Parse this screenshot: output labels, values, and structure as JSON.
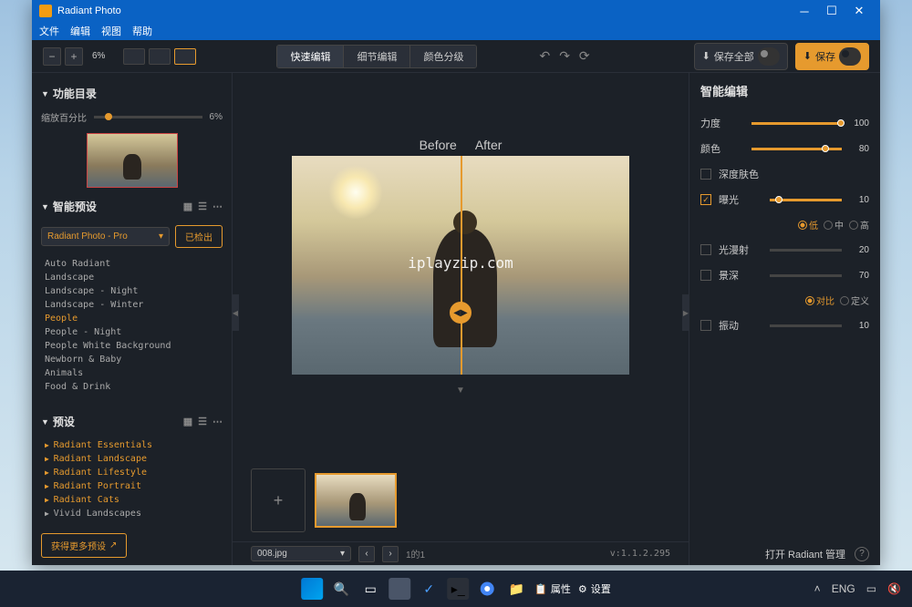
{
  "titlebar": {
    "title": "Radiant Photo"
  },
  "menubar": {
    "file": "文件",
    "edit": "编辑",
    "view": "视图",
    "help": "帮助"
  },
  "toolbar": {
    "zoom_value": "6%",
    "tabs": {
      "quick": "快速编辑",
      "detail": "细节编辑",
      "color": "颜色分级"
    },
    "save_all": "保存全部",
    "save": "保存"
  },
  "left": {
    "section1": "功能目录",
    "scale_label": "缩放百分比",
    "scale_value": "6%",
    "section2": "智能预设",
    "preset_selected": "Radiant Photo - Pro",
    "detect_btn": "已检出",
    "presets": [
      "Auto Radiant",
      "Landscape",
      "Landscape - Night",
      "Landscape - Winter",
      "People",
      "People - Night",
      "People White Background",
      "Newborn & Baby",
      "Animals",
      "Food & Drink"
    ],
    "active_preset_index": 4,
    "section3": "预设",
    "categories": [
      "Radiant Essentials",
      "Radiant Landscape",
      "Radiant Lifestyle",
      "Radiant Portrait",
      "Radiant Cats",
      "Vivid Landscapes"
    ],
    "more_btn": "获得更多预设"
  },
  "main": {
    "before": "Before",
    "after": "After",
    "watermark": "iplayzip.com",
    "filename": "008.jpg",
    "page": "1的1",
    "version": "v:1.1.2.295"
  },
  "right": {
    "title": "智能编辑",
    "strength": {
      "label": "力度",
      "value": "100"
    },
    "color": {
      "label": "颜色",
      "value": "80"
    },
    "skin": {
      "label": "深度肤色"
    },
    "expo": {
      "label": "曝光",
      "value": "10",
      "low": "低",
      "mid": "中",
      "high": "高"
    },
    "diffuse": {
      "label": "光漫射",
      "value": "20"
    },
    "depth": {
      "label": "景深",
      "value": "70"
    },
    "contrast_label": "对比",
    "custom_label": "定义",
    "vibrance": {
      "label": "振动",
      "value": "10"
    },
    "open_manager": "打开 Radiant 管理"
  },
  "taskbar": {
    "props": "属性",
    "settings": "设置",
    "lang": "ENG"
  }
}
